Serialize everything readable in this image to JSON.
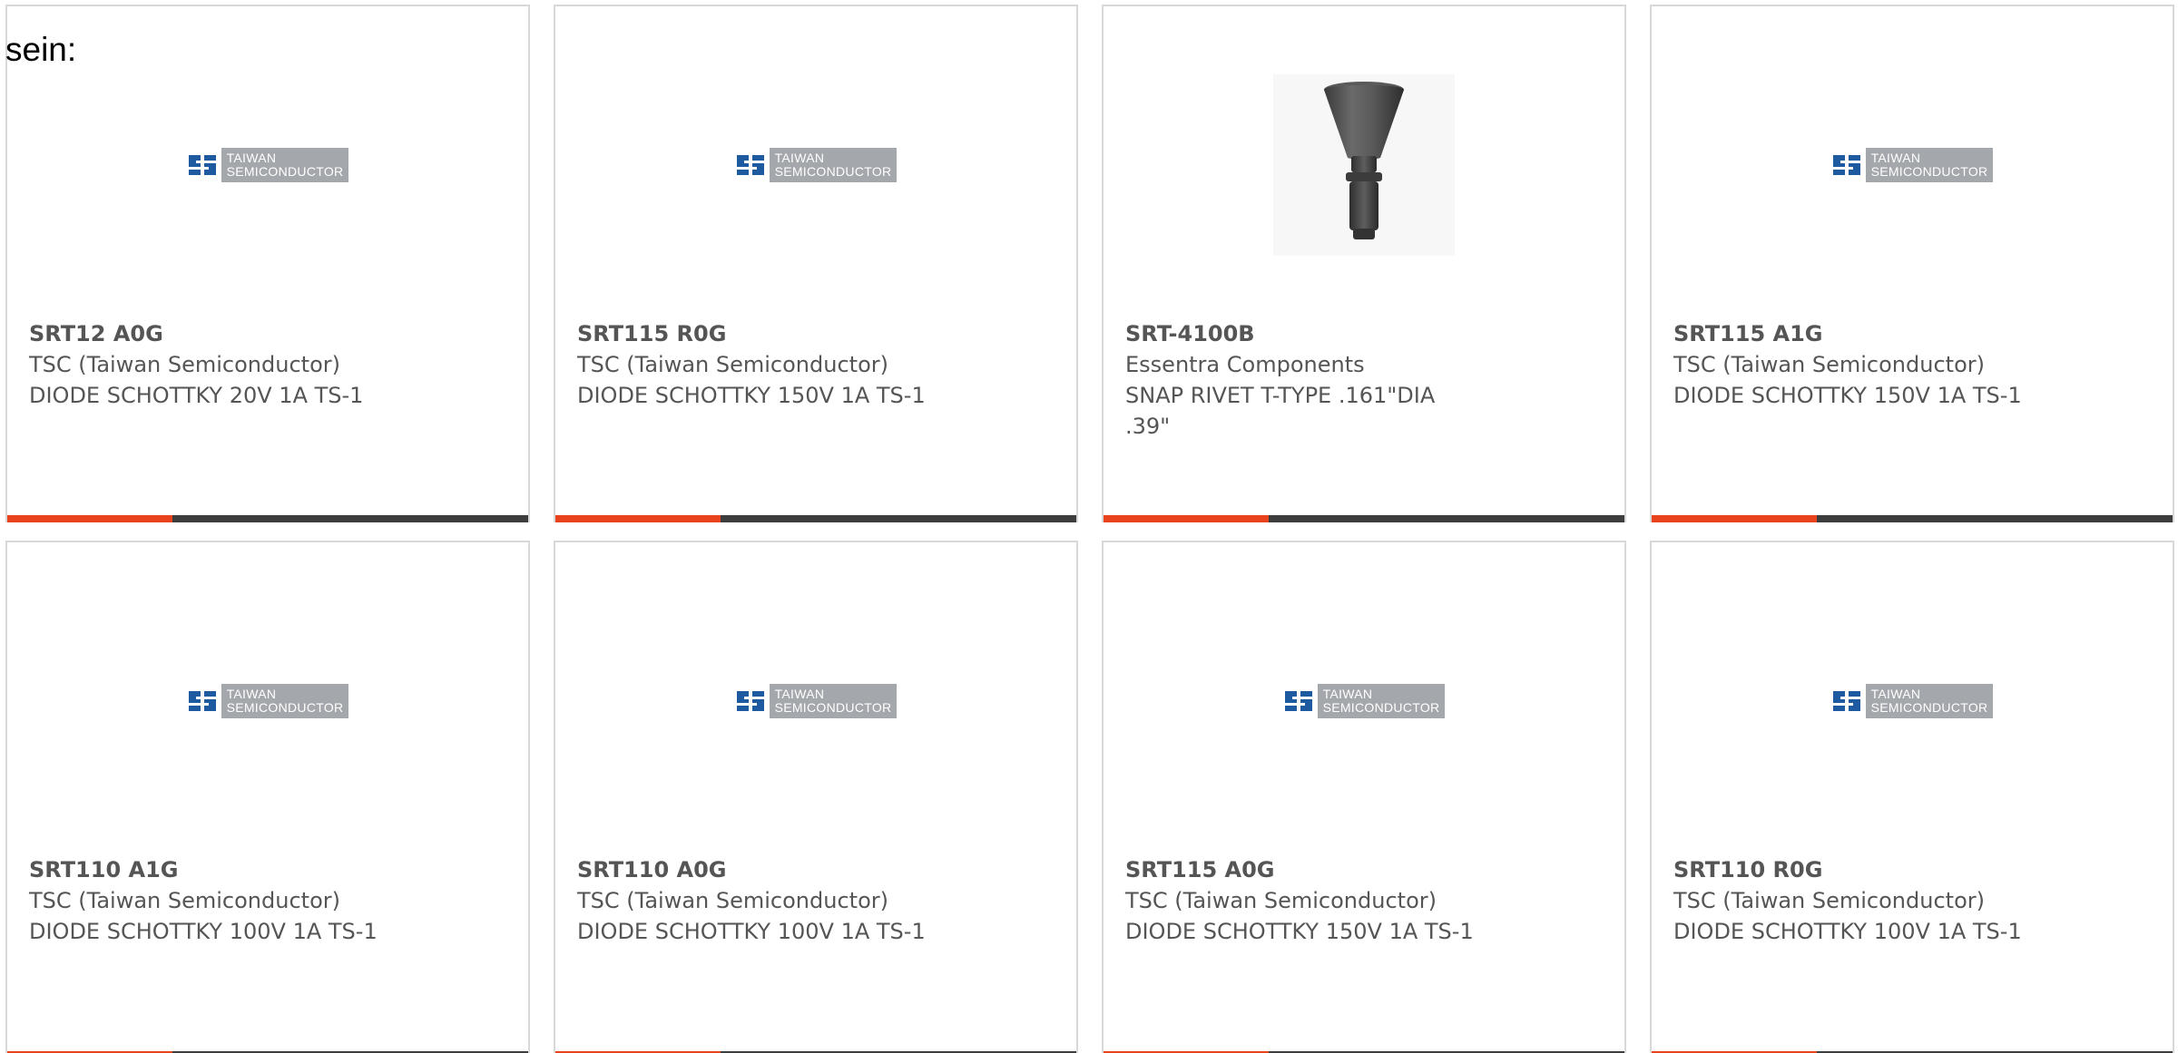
{
  "intro_text": "sein:",
  "colors": {
    "accent": "#e8431c",
    "bar": "#3d3d3d",
    "card_border": "#d8d8d8",
    "text": "#555555",
    "logo_plate": "#a4a7ab",
    "logo_blue": "#1e5aa0"
  },
  "brand_logo": {
    "line1": "TAIWAN",
    "line2": "SEMICONDUCTOR"
  },
  "products": [
    {
      "part_number": "SRT12 A0G",
      "manufacturer": "TSC (Taiwan Semiconductor)",
      "description": "DIODE SCHOTTKY 20V 1A TS-1",
      "image": "tsc-logo"
    },
    {
      "part_number": "SRT115 R0G",
      "manufacturer": "TSC (Taiwan Semiconductor)",
      "description": "DIODE SCHOTTKY 150V 1A TS-1",
      "image": "tsc-logo"
    },
    {
      "part_number": "SRT-4100B",
      "manufacturer": "Essentra Components",
      "description": "SNAP RIVET T-TYPE .161\"DIA .39\"",
      "image": "snap-rivet"
    },
    {
      "part_number": "SRT115 A1G",
      "manufacturer": "TSC (Taiwan Semiconductor)",
      "description": "DIODE SCHOTTKY 150V 1A TS-1",
      "image": "tsc-logo"
    },
    {
      "part_number": "SRT110 A1G",
      "manufacturer": "TSC (Taiwan Semiconductor)",
      "description": "DIODE SCHOTTKY 100V 1A TS-1",
      "image": "tsc-logo"
    },
    {
      "part_number": "SRT110 A0G",
      "manufacturer": "TSC (Taiwan Semiconductor)",
      "description": "DIODE SCHOTTKY 100V 1A TS-1",
      "image": "tsc-logo"
    },
    {
      "part_number": "SRT115 A0G",
      "manufacturer": "TSC (Taiwan Semiconductor)",
      "description": "DIODE SCHOTTKY 150V 1A TS-1",
      "image": "tsc-logo"
    },
    {
      "part_number": "SRT110 R0G",
      "manufacturer": "TSC (Taiwan Semiconductor)",
      "description": "DIODE SCHOTTKY 100V 1A TS-1",
      "image": "tsc-logo"
    }
  ]
}
